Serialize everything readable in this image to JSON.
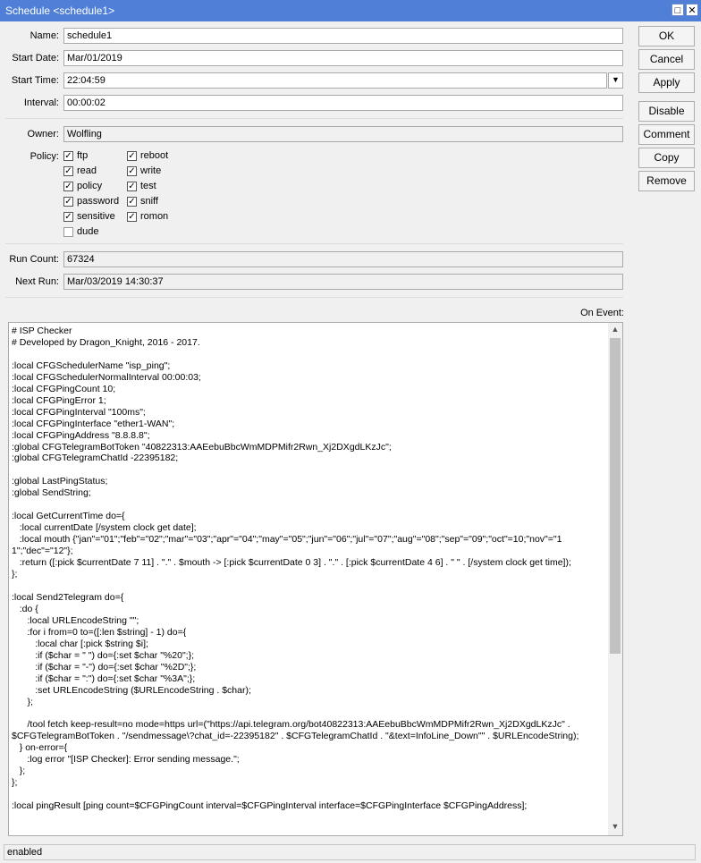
{
  "window": {
    "title": "Schedule <schedule1>"
  },
  "form": {
    "name_label": "Name:",
    "name_value": "schedule1",
    "start_date_label": "Start Date:",
    "start_date_value": "Mar/01/2019",
    "start_time_label": "Start Time:",
    "start_time_value": "22:04:59",
    "interval_label": "Interval:",
    "interval_value": "00:00:02",
    "owner_label": "Owner:",
    "owner_value": "Wolfling",
    "policy_label": "Policy:",
    "run_count_label": "Run Count:",
    "run_count_value": "67324",
    "next_run_label": "Next Run:",
    "next_run_value": "Mar/03/2019 14:30:37",
    "on_event_label": "On Event:"
  },
  "policies": [
    {
      "label": "ftp",
      "checked": true
    },
    {
      "label": "reboot",
      "checked": true
    },
    {
      "label": "read",
      "checked": true
    },
    {
      "label": "write",
      "checked": true
    },
    {
      "label": "policy",
      "checked": true
    },
    {
      "label": "test",
      "checked": true
    },
    {
      "label": "password",
      "checked": true
    },
    {
      "label": "sniff",
      "checked": true
    },
    {
      "label": "sensitive",
      "checked": true
    },
    {
      "label": "romon",
      "checked": true
    },
    {
      "label": "dude",
      "checked": false
    }
  ],
  "buttons": {
    "ok": "OK",
    "cancel": "Cancel",
    "apply": "Apply",
    "disable": "Disable",
    "comment": "Comment",
    "copy": "Copy",
    "remove": "Remove"
  },
  "on_event_script": "# ISP Checker\n# Developed by Dragon_Knight, 2016 - 2017.\n\n:local CFGSchedulerName \"isp_ping\";\n:local CFGSchedulerNormalInterval 00:00:03;\n:local CFGPingCount 10;\n:local CFGPingError 1;\n:local CFGPingInterval \"100ms\";\n:local CFGPingInterface \"ether1-WAN\";\n:local CFGPingAddress \"8.8.8.8\";\n:global CFGTelegramBotToken \"40822313:AAEebuBbcWmMDPMifr2Rwn_Xj2DXgdLKzJc\";\n:global CFGTelegramChatId -22395182;\n\n:global LastPingStatus;\n:global SendString;\n\n:local GetCurrentTime do={\n   :local currentDate [/system clock get date];\n   :local mouth {\"jan\"=\"01\";\"feb\"=\"02\";\"mar\"=\"03\";\"apr\"=\"04\";\"may\"=\"05\";\"jun\"=\"06\";\"jul\"=\"07\";\"aug\"=\"08\";\"sep\"=\"09\";\"oct\"=10;\"nov\"=\"11\";\"dec\"=\"12\"};\n   :return ([:pick $currentDate 7 11] . \".\" . $mouth -> [:pick $currentDate 0 3] . \".\" . [:pick $currentDate 4 6] . \" \" . [/system clock get time]);\n};\n\n:local Send2Telegram do={\n   :do {\n      :local URLEncodeString \"\";\n      :for i from=0 to=([:len $string] - 1) do={\n         :local char [:pick $string $i];\n         :if ($char = \" \") do={:set $char \"%20\";};\n         :if ($char = \"-\") do={:set $char \"%2D\";};\n         :if ($char = \":\") do={:set $char \"%3A\";};\n         :set URLEncodeString ($URLEncodeString . $char);\n      };\n\n      /tool fetch keep-result=no mode=https url=(\"https://api.telegram.org/bot40822313:AAEebuBbcWmMDPMifr2Rwn_Xj2DXgdLKzJc\" . $CFGTelegramBotToken . \"/sendmessage\\?chat_id=-22395182\" . $CFGTelegramChatId . \"&text=InfoLine_Down\"\" . $URLEncodeString);\n   } on-error={\n      :log error \"[ISP Checker]: Error sending message.\";\n   };\n};\n\n:local pingResult [ping count=$CFGPingCount interval=$CFGPingInterval interface=$CFGPingInterface $CFGPingAddress];",
  "status": {
    "text": "enabled"
  }
}
